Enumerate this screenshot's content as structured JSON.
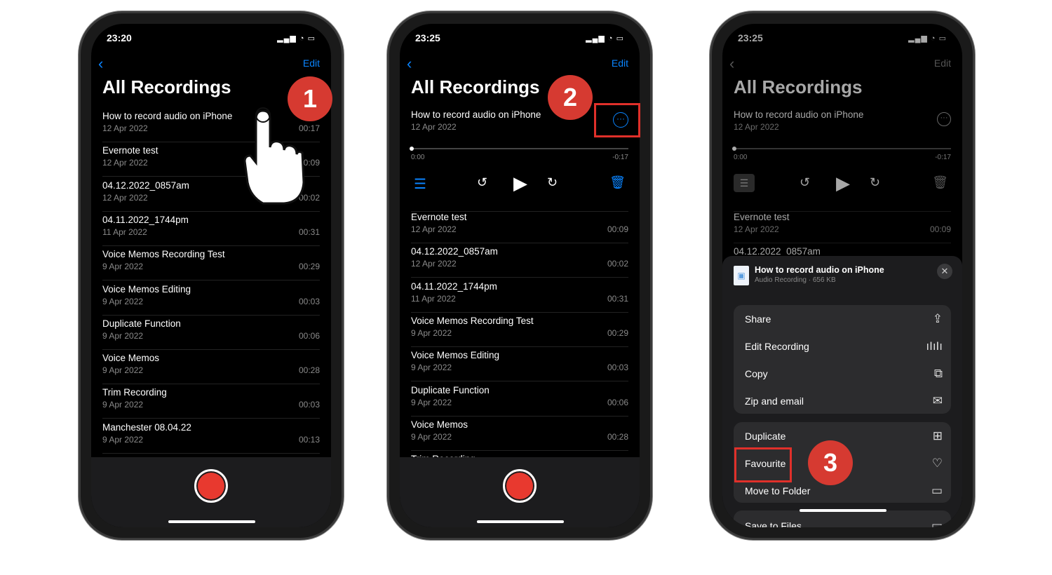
{
  "colors": {
    "accent": "#0a84ff",
    "record": "#e8392f",
    "annotation": "#d63a31"
  },
  "common": {
    "edit": "Edit",
    "title": "All Recordings",
    "back": "‹",
    "status": "▂▄▆ ◔ ▭"
  },
  "phone1": {
    "time": "23:20",
    "badge": "1",
    "recordings": [
      {
        "name": "How to record audio on iPhone",
        "date": "12 Apr 2022",
        "duration": "00:17"
      },
      {
        "name": "Evernote test",
        "date": "12 Apr 2022",
        "duration": "00:09"
      },
      {
        "name": "04.12.2022_0857am",
        "date": "12 Apr 2022",
        "duration": "00:02"
      },
      {
        "name": "04.11.2022_1744pm",
        "date": "11 Apr 2022",
        "duration": "00:31"
      },
      {
        "name": "Voice Memos Recording Test",
        "date": "9 Apr 2022",
        "duration": "00:29"
      },
      {
        "name": "Voice Memos Editing",
        "date": "9 Apr 2022",
        "duration": "00:03"
      },
      {
        "name": "Duplicate Function",
        "date": "9 Apr 2022",
        "duration": "00:06"
      },
      {
        "name": "Voice Memos",
        "date": "9 Apr 2022",
        "duration": "00:28"
      },
      {
        "name": "Trim Recording",
        "date": "9 Apr 2022",
        "duration": "00:03"
      },
      {
        "name": "Manchester 08.04.22",
        "date": "9 Apr 2022",
        "duration": "00:13"
      }
    ]
  },
  "phone2": {
    "time": "23:25",
    "badge": "2",
    "expanded": {
      "name": "How to record audio on iPhone",
      "date": "12 Apr 2022",
      "elapsed": "0:00",
      "remaining": "-0:17",
      "progress": 0
    },
    "recordings": [
      {
        "name": "Evernote test",
        "date": "12 Apr 2022",
        "duration": "00:09"
      },
      {
        "name": "04.12.2022_0857am",
        "date": "12 Apr 2022",
        "duration": "00:02"
      },
      {
        "name": "04.11.2022_1744pm",
        "date": "11 Apr 2022",
        "duration": "00:31"
      },
      {
        "name": "Voice Memos Recording Test",
        "date": "9 Apr 2022",
        "duration": "00:29"
      },
      {
        "name": "Voice Memos Editing",
        "date": "9 Apr 2022",
        "duration": "00:03"
      },
      {
        "name": "Duplicate Function",
        "date": "9 Apr 2022",
        "duration": "00:06"
      },
      {
        "name": "Voice Memos",
        "date": "9 Apr 2022",
        "duration": "00:28"
      },
      {
        "name": "Trim Recording",
        "date": "",
        "duration": ""
      }
    ]
  },
  "phone3": {
    "time": "23:25",
    "badge": "3",
    "expanded": {
      "name": "How to record audio on iPhone",
      "date": "12 Apr 2022",
      "elapsed": "0:00",
      "remaining": "-0:17"
    },
    "recordings": [
      {
        "name": "Evernote test",
        "date": "12 Apr 2022",
        "duration": "00:09"
      },
      {
        "name": "04.12.2022_0857am",
        "date": "",
        "duration": ""
      }
    ],
    "sheet": {
      "file_name": "How to record audio on iPhone",
      "file_info": "Audio Recording · 656 KB",
      "group1": [
        {
          "label": "Share",
          "icon": "share-icon",
          "glyph": "⇪"
        },
        {
          "label": "Edit Recording",
          "icon": "waveform-icon",
          "glyph": "ıIıIı"
        },
        {
          "label": "Copy",
          "icon": "copy-icon",
          "glyph": "⧉"
        },
        {
          "label": "Zip and email",
          "icon": "envelope-icon",
          "glyph": "✉"
        }
      ],
      "group2": [
        {
          "label": "Duplicate",
          "icon": "duplicate-icon",
          "glyph": "⊞"
        },
        {
          "label": "Favourite",
          "icon": "heart-icon",
          "glyph": "♡"
        },
        {
          "label": "Move to Folder",
          "icon": "folder-icon",
          "glyph": "▭"
        }
      ],
      "group3": [
        {
          "label": "Save to Files",
          "icon": "folder-icon",
          "glyph": "▭"
        }
      ]
    }
  }
}
